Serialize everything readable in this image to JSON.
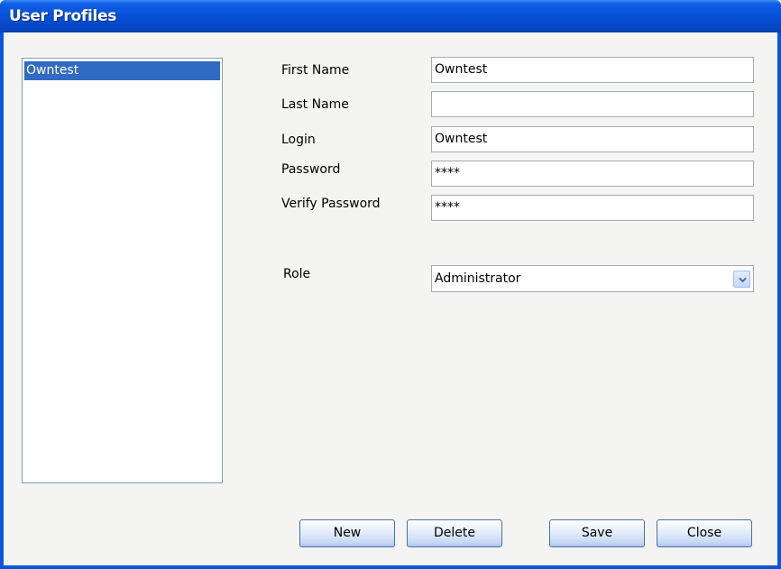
{
  "window": {
    "title": "User Profiles"
  },
  "users": {
    "items": [
      "Owntest"
    ],
    "selected": "Owntest"
  },
  "form": {
    "first_name": {
      "label": "First Name",
      "value": "Owntest"
    },
    "last_name": {
      "label": "Last Name",
      "value": ""
    },
    "login": {
      "label": "Login",
      "value": "Owntest"
    },
    "password": {
      "label": "Password",
      "value": "****"
    },
    "verify_password": {
      "label": "Verify Password",
      "value": "****"
    },
    "role": {
      "label": "Role",
      "value": "Administrator"
    }
  },
  "buttons": {
    "new": "New",
    "delete": "Delete",
    "save": "Save",
    "close": "Close"
  },
  "colors": {
    "title_bar": "#0751d8",
    "selection": "#316ac5",
    "client_bg": "#f4f4f2"
  },
  "icons": {
    "role_dropdown": "chevron-down-icon"
  }
}
